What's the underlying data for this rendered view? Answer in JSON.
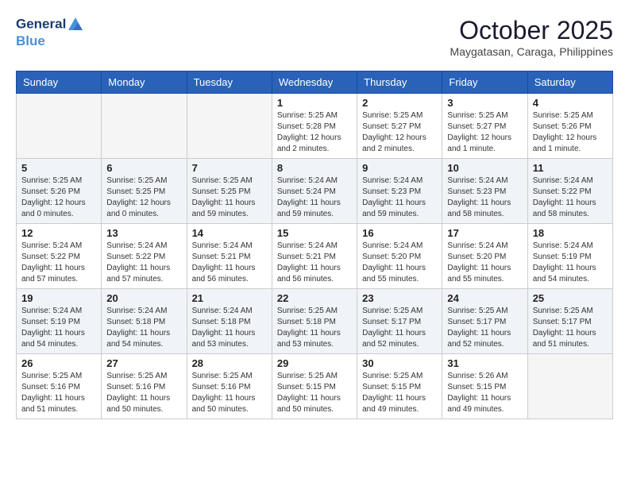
{
  "header": {
    "logo_line1": "General",
    "logo_line2": "Blue",
    "month": "October 2025",
    "location": "Maygatasan, Caraga, Philippines"
  },
  "days_of_week": [
    "Sunday",
    "Monday",
    "Tuesday",
    "Wednesday",
    "Thursday",
    "Friday",
    "Saturday"
  ],
  "weeks": [
    [
      {
        "day": "",
        "info": ""
      },
      {
        "day": "",
        "info": ""
      },
      {
        "day": "",
        "info": ""
      },
      {
        "day": "1",
        "info": "Sunrise: 5:25 AM\nSunset: 5:28 PM\nDaylight: 12 hours and 2 minutes."
      },
      {
        "day": "2",
        "info": "Sunrise: 5:25 AM\nSunset: 5:27 PM\nDaylight: 12 hours and 2 minutes."
      },
      {
        "day": "3",
        "info": "Sunrise: 5:25 AM\nSunset: 5:27 PM\nDaylight: 12 hours and 1 minute."
      },
      {
        "day": "4",
        "info": "Sunrise: 5:25 AM\nSunset: 5:26 PM\nDaylight: 12 hours and 1 minute."
      }
    ],
    [
      {
        "day": "5",
        "info": "Sunrise: 5:25 AM\nSunset: 5:26 PM\nDaylight: 12 hours and 0 minutes."
      },
      {
        "day": "6",
        "info": "Sunrise: 5:25 AM\nSunset: 5:25 PM\nDaylight: 12 hours and 0 minutes."
      },
      {
        "day": "7",
        "info": "Sunrise: 5:25 AM\nSunset: 5:25 PM\nDaylight: 11 hours and 59 minutes."
      },
      {
        "day": "8",
        "info": "Sunrise: 5:24 AM\nSunset: 5:24 PM\nDaylight: 11 hours and 59 minutes."
      },
      {
        "day": "9",
        "info": "Sunrise: 5:24 AM\nSunset: 5:23 PM\nDaylight: 11 hours and 59 minutes."
      },
      {
        "day": "10",
        "info": "Sunrise: 5:24 AM\nSunset: 5:23 PM\nDaylight: 11 hours and 58 minutes."
      },
      {
        "day": "11",
        "info": "Sunrise: 5:24 AM\nSunset: 5:22 PM\nDaylight: 11 hours and 58 minutes."
      }
    ],
    [
      {
        "day": "12",
        "info": "Sunrise: 5:24 AM\nSunset: 5:22 PM\nDaylight: 11 hours and 57 minutes."
      },
      {
        "day": "13",
        "info": "Sunrise: 5:24 AM\nSunset: 5:22 PM\nDaylight: 11 hours and 57 minutes."
      },
      {
        "day": "14",
        "info": "Sunrise: 5:24 AM\nSunset: 5:21 PM\nDaylight: 11 hours and 56 minutes."
      },
      {
        "day": "15",
        "info": "Sunrise: 5:24 AM\nSunset: 5:21 PM\nDaylight: 11 hours and 56 minutes."
      },
      {
        "day": "16",
        "info": "Sunrise: 5:24 AM\nSunset: 5:20 PM\nDaylight: 11 hours and 55 minutes."
      },
      {
        "day": "17",
        "info": "Sunrise: 5:24 AM\nSunset: 5:20 PM\nDaylight: 11 hours and 55 minutes."
      },
      {
        "day": "18",
        "info": "Sunrise: 5:24 AM\nSunset: 5:19 PM\nDaylight: 11 hours and 54 minutes."
      }
    ],
    [
      {
        "day": "19",
        "info": "Sunrise: 5:24 AM\nSunset: 5:19 PM\nDaylight: 11 hours and 54 minutes."
      },
      {
        "day": "20",
        "info": "Sunrise: 5:24 AM\nSunset: 5:18 PM\nDaylight: 11 hours and 54 minutes."
      },
      {
        "day": "21",
        "info": "Sunrise: 5:24 AM\nSunset: 5:18 PM\nDaylight: 11 hours and 53 minutes."
      },
      {
        "day": "22",
        "info": "Sunrise: 5:25 AM\nSunset: 5:18 PM\nDaylight: 11 hours and 53 minutes."
      },
      {
        "day": "23",
        "info": "Sunrise: 5:25 AM\nSunset: 5:17 PM\nDaylight: 11 hours and 52 minutes."
      },
      {
        "day": "24",
        "info": "Sunrise: 5:25 AM\nSunset: 5:17 PM\nDaylight: 11 hours and 52 minutes."
      },
      {
        "day": "25",
        "info": "Sunrise: 5:25 AM\nSunset: 5:17 PM\nDaylight: 11 hours and 51 minutes."
      }
    ],
    [
      {
        "day": "26",
        "info": "Sunrise: 5:25 AM\nSunset: 5:16 PM\nDaylight: 11 hours and 51 minutes."
      },
      {
        "day": "27",
        "info": "Sunrise: 5:25 AM\nSunset: 5:16 PM\nDaylight: 11 hours and 50 minutes."
      },
      {
        "day": "28",
        "info": "Sunrise: 5:25 AM\nSunset: 5:16 PM\nDaylight: 11 hours and 50 minutes."
      },
      {
        "day": "29",
        "info": "Sunrise: 5:25 AM\nSunset: 5:15 PM\nDaylight: 11 hours and 50 minutes."
      },
      {
        "day": "30",
        "info": "Sunrise: 5:25 AM\nSunset: 5:15 PM\nDaylight: 11 hours and 49 minutes."
      },
      {
        "day": "31",
        "info": "Sunrise: 5:26 AM\nSunset: 5:15 PM\nDaylight: 11 hours and 49 minutes."
      },
      {
        "day": "",
        "info": ""
      }
    ]
  ]
}
